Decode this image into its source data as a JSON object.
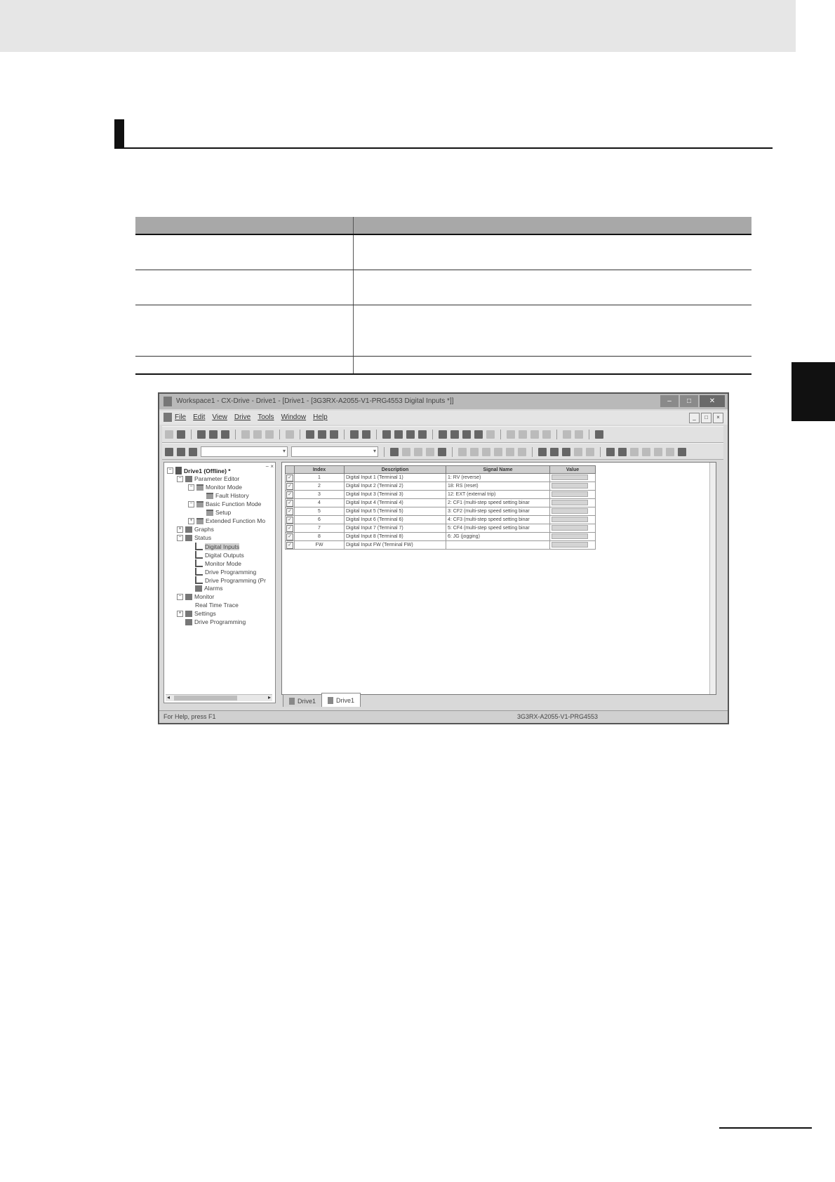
{
  "window": {
    "title": "Workspace1 - CX-Drive - Drive1 - [Drive1 - [3G3RX-A2055-V1-PRG4553 Digital Inputs *]]"
  },
  "menu": [
    "File",
    "Edit",
    "View",
    "Drive",
    "Tools",
    "Window",
    "Help"
  ],
  "tree": {
    "items": [
      {
        "label": "Drive1 (Offline) *"
      },
      {
        "label": "Parameter Editor"
      },
      {
        "label": "Monitor Mode"
      },
      {
        "label": "Fault History"
      },
      {
        "label": "Basic Function Mode"
      },
      {
        "label": "Setup"
      },
      {
        "label": "Extended Function Mo"
      },
      {
        "label": "Graphs"
      },
      {
        "label": "Status"
      },
      {
        "label": "Digital Inputs"
      },
      {
        "label": "Digital Outputs"
      },
      {
        "label": "Monitor Mode"
      },
      {
        "label": "Drive Programming"
      },
      {
        "label": "Drive Programming (Pr"
      },
      {
        "label": "Alarms"
      },
      {
        "label": "Monitor"
      },
      {
        "label": "Real Time Trace"
      },
      {
        "label": "Settings"
      },
      {
        "label": "Drive Programming"
      }
    ]
  },
  "grid": {
    "headers": [
      "Index",
      "Description",
      "Signal Name",
      "Value"
    ],
    "rows": [
      {
        "index": "1",
        "description": "Digital Input 1 (Terminal 1)",
        "signal": "1: RV (reverse)"
      },
      {
        "index": "2",
        "description": "Digital Input 2 (Terminal 2)",
        "signal": "18: RS (reset)"
      },
      {
        "index": "3",
        "description": "Digital Input 3 (Terminal 3)",
        "signal": "12: EXT (external trip)"
      },
      {
        "index": "4",
        "description": "Digital Input 4 (Terminal 4)",
        "signal": "2: CF1 (multi-step speed setting binar"
      },
      {
        "index": "5",
        "description": "Digital Input 5 (Terminal 5)",
        "signal": "3: CF2 (multi-step speed setting binar"
      },
      {
        "index": "6",
        "description": "Digital Input 6 (Terminal 6)",
        "signal": "4: CF3 (multi-step speed setting binar"
      },
      {
        "index": "7",
        "description": "Digital Input 7 (Terminal 7)",
        "signal": "5: CF4 (multi-step speed setting binar"
      },
      {
        "index": "8",
        "description": "Digital Input 8 (Terminal 8)",
        "signal": "6: JG (jogging)"
      },
      {
        "index": "FW",
        "description": "Digital Input FW (Terminal FW)",
        "signal": ""
      }
    ]
  },
  "tabs": [
    "Drive1",
    "Drive1"
  ],
  "status": {
    "help": "For Help, press F1",
    "model": "3G3RX-A2055-V1-PRG4553"
  }
}
